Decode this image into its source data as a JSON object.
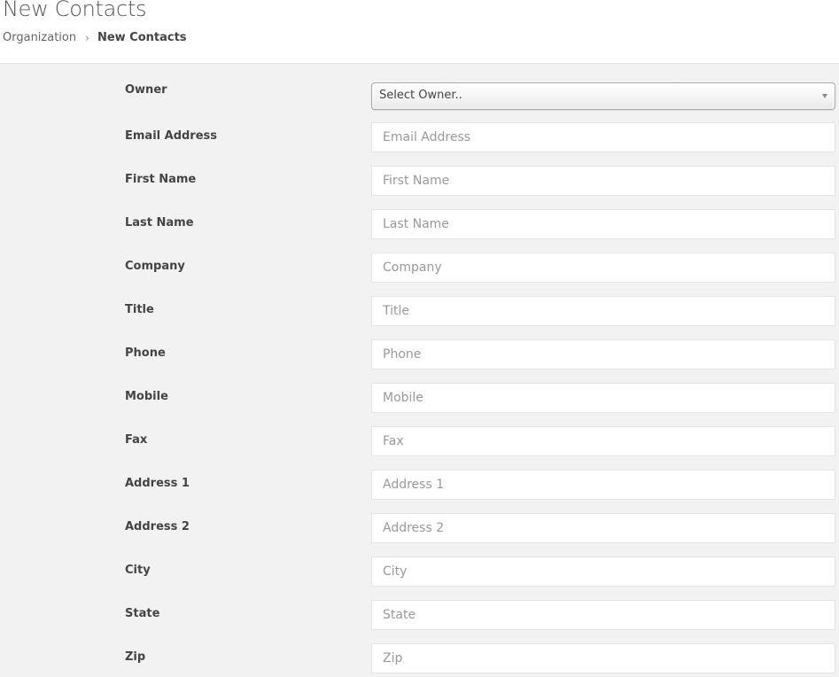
{
  "header": {
    "title": "New Contacts",
    "breadcrumb": {
      "parent": "Organization",
      "separator": "›",
      "current": "New Contacts"
    }
  },
  "form": {
    "owner": {
      "label": "Owner",
      "selected": "Select Owner.."
    },
    "fields": [
      {
        "label": "Email Address",
        "placeholder": "Email Address",
        "value": ""
      },
      {
        "label": "First Name",
        "placeholder": "First Name",
        "value": ""
      },
      {
        "label": "Last Name",
        "placeholder": "Last Name",
        "value": ""
      },
      {
        "label": "Company",
        "placeholder": "Company",
        "value": ""
      },
      {
        "label": "Title",
        "placeholder": "Title",
        "value": ""
      },
      {
        "label": "Phone",
        "placeholder": "Phone",
        "value": ""
      },
      {
        "label": "Mobile",
        "placeholder": "Mobile",
        "value": ""
      },
      {
        "label": "Fax",
        "placeholder": "Fax",
        "value": ""
      },
      {
        "label": "Address 1",
        "placeholder": "Address 1",
        "value": ""
      },
      {
        "label": "Address 2",
        "placeholder": "Address 2",
        "value": ""
      },
      {
        "label": "City",
        "placeholder": "City",
        "value": ""
      },
      {
        "label": "State",
        "placeholder": "State",
        "value": ""
      },
      {
        "label": "Zip",
        "placeholder": "Zip",
        "value": ""
      }
    ]
  }
}
